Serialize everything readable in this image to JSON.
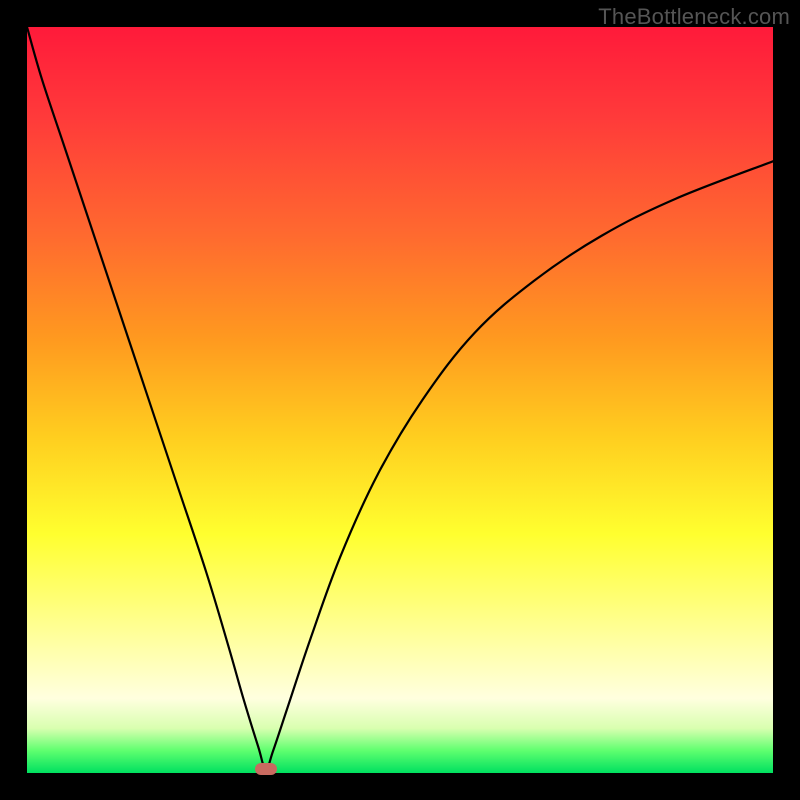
{
  "watermark": "TheBottleneck.com",
  "colors": {
    "frame": "#000000",
    "curve": "#000000",
    "marker": "#c96a60",
    "gradient_top": "#ff1a3a",
    "gradient_bottom": "#00e060"
  },
  "chart_data": {
    "type": "line",
    "title": "",
    "xlabel": "",
    "ylabel": "",
    "xlim": [
      0,
      100
    ],
    "ylim": [
      0,
      100
    ],
    "grid": false,
    "legend": false,
    "description": "Single V-shaped bottleneck curve on a rainbow background; minimum near x≈32 at y≈0.5.",
    "series": [
      {
        "name": "bottleneck",
        "x": [
          0,
          2,
          5,
          8,
          12,
          16,
          20,
          24,
          27,
          29,
          31,
          32,
          33,
          35,
          38,
          42,
          47,
          53,
          60,
          68,
          77,
          87,
          100
        ],
        "y": [
          100,
          93,
          84,
          75,
          63,
          51,
          39,
          27,
          17,
          10,
          3.5,
          0.5,
          3,
          9,
          18,
          29,
          40,
          50,
          59,
          66,
          72,
          77,
          82
        ]
      }
    ],
    "marker": {
      "x": 32,
      "y": 0.5
    }
  }
}
